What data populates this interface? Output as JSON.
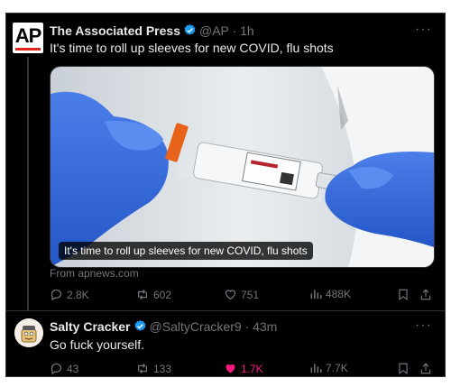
{
  "colors": {
    "background": "#000000",
    "text": "#e7e9ea",
    "muted": "#71767b",
    "verified": "#1d9bf0",
    "like": "#f91880"
  },
  "tweets": [
    {
      "author": "The Associated Press",
      "handle": "@AP",
      "time": "· 1h",
      "text": "It's time to roll up sleeves for new COVID, flu shots",
      "media_caption": "It's time to roll up sleeves for new COVID, flu shots",
      "source": "From apnews.com",
      "logo_text": "AP",
      "stats": {
        "replies": "2.8K",
        "retweets": "602",
        "likes": "751",
        "views": "488K"
      }
    },
    {
      "author": "Salty Cracker",
      "handle": "@SaltyCracker9",
      "time": "· 43m",
      "text": "Go fuck yourself.",
      "stats": {
        "replies": "43",
        "retweets": "133",
        "likes": "1.7K",
        "views": "7.7K"
      }
    }
  ],
  "icons": [
    "ap-logo",
    "verified-badge-icon",
    "more-icon",
    "reply-icon",
    "retweet-icon",
    "like-icon",
    "views-icon",
    "bookmark-icon",
    "share-icon"
  ]
}
